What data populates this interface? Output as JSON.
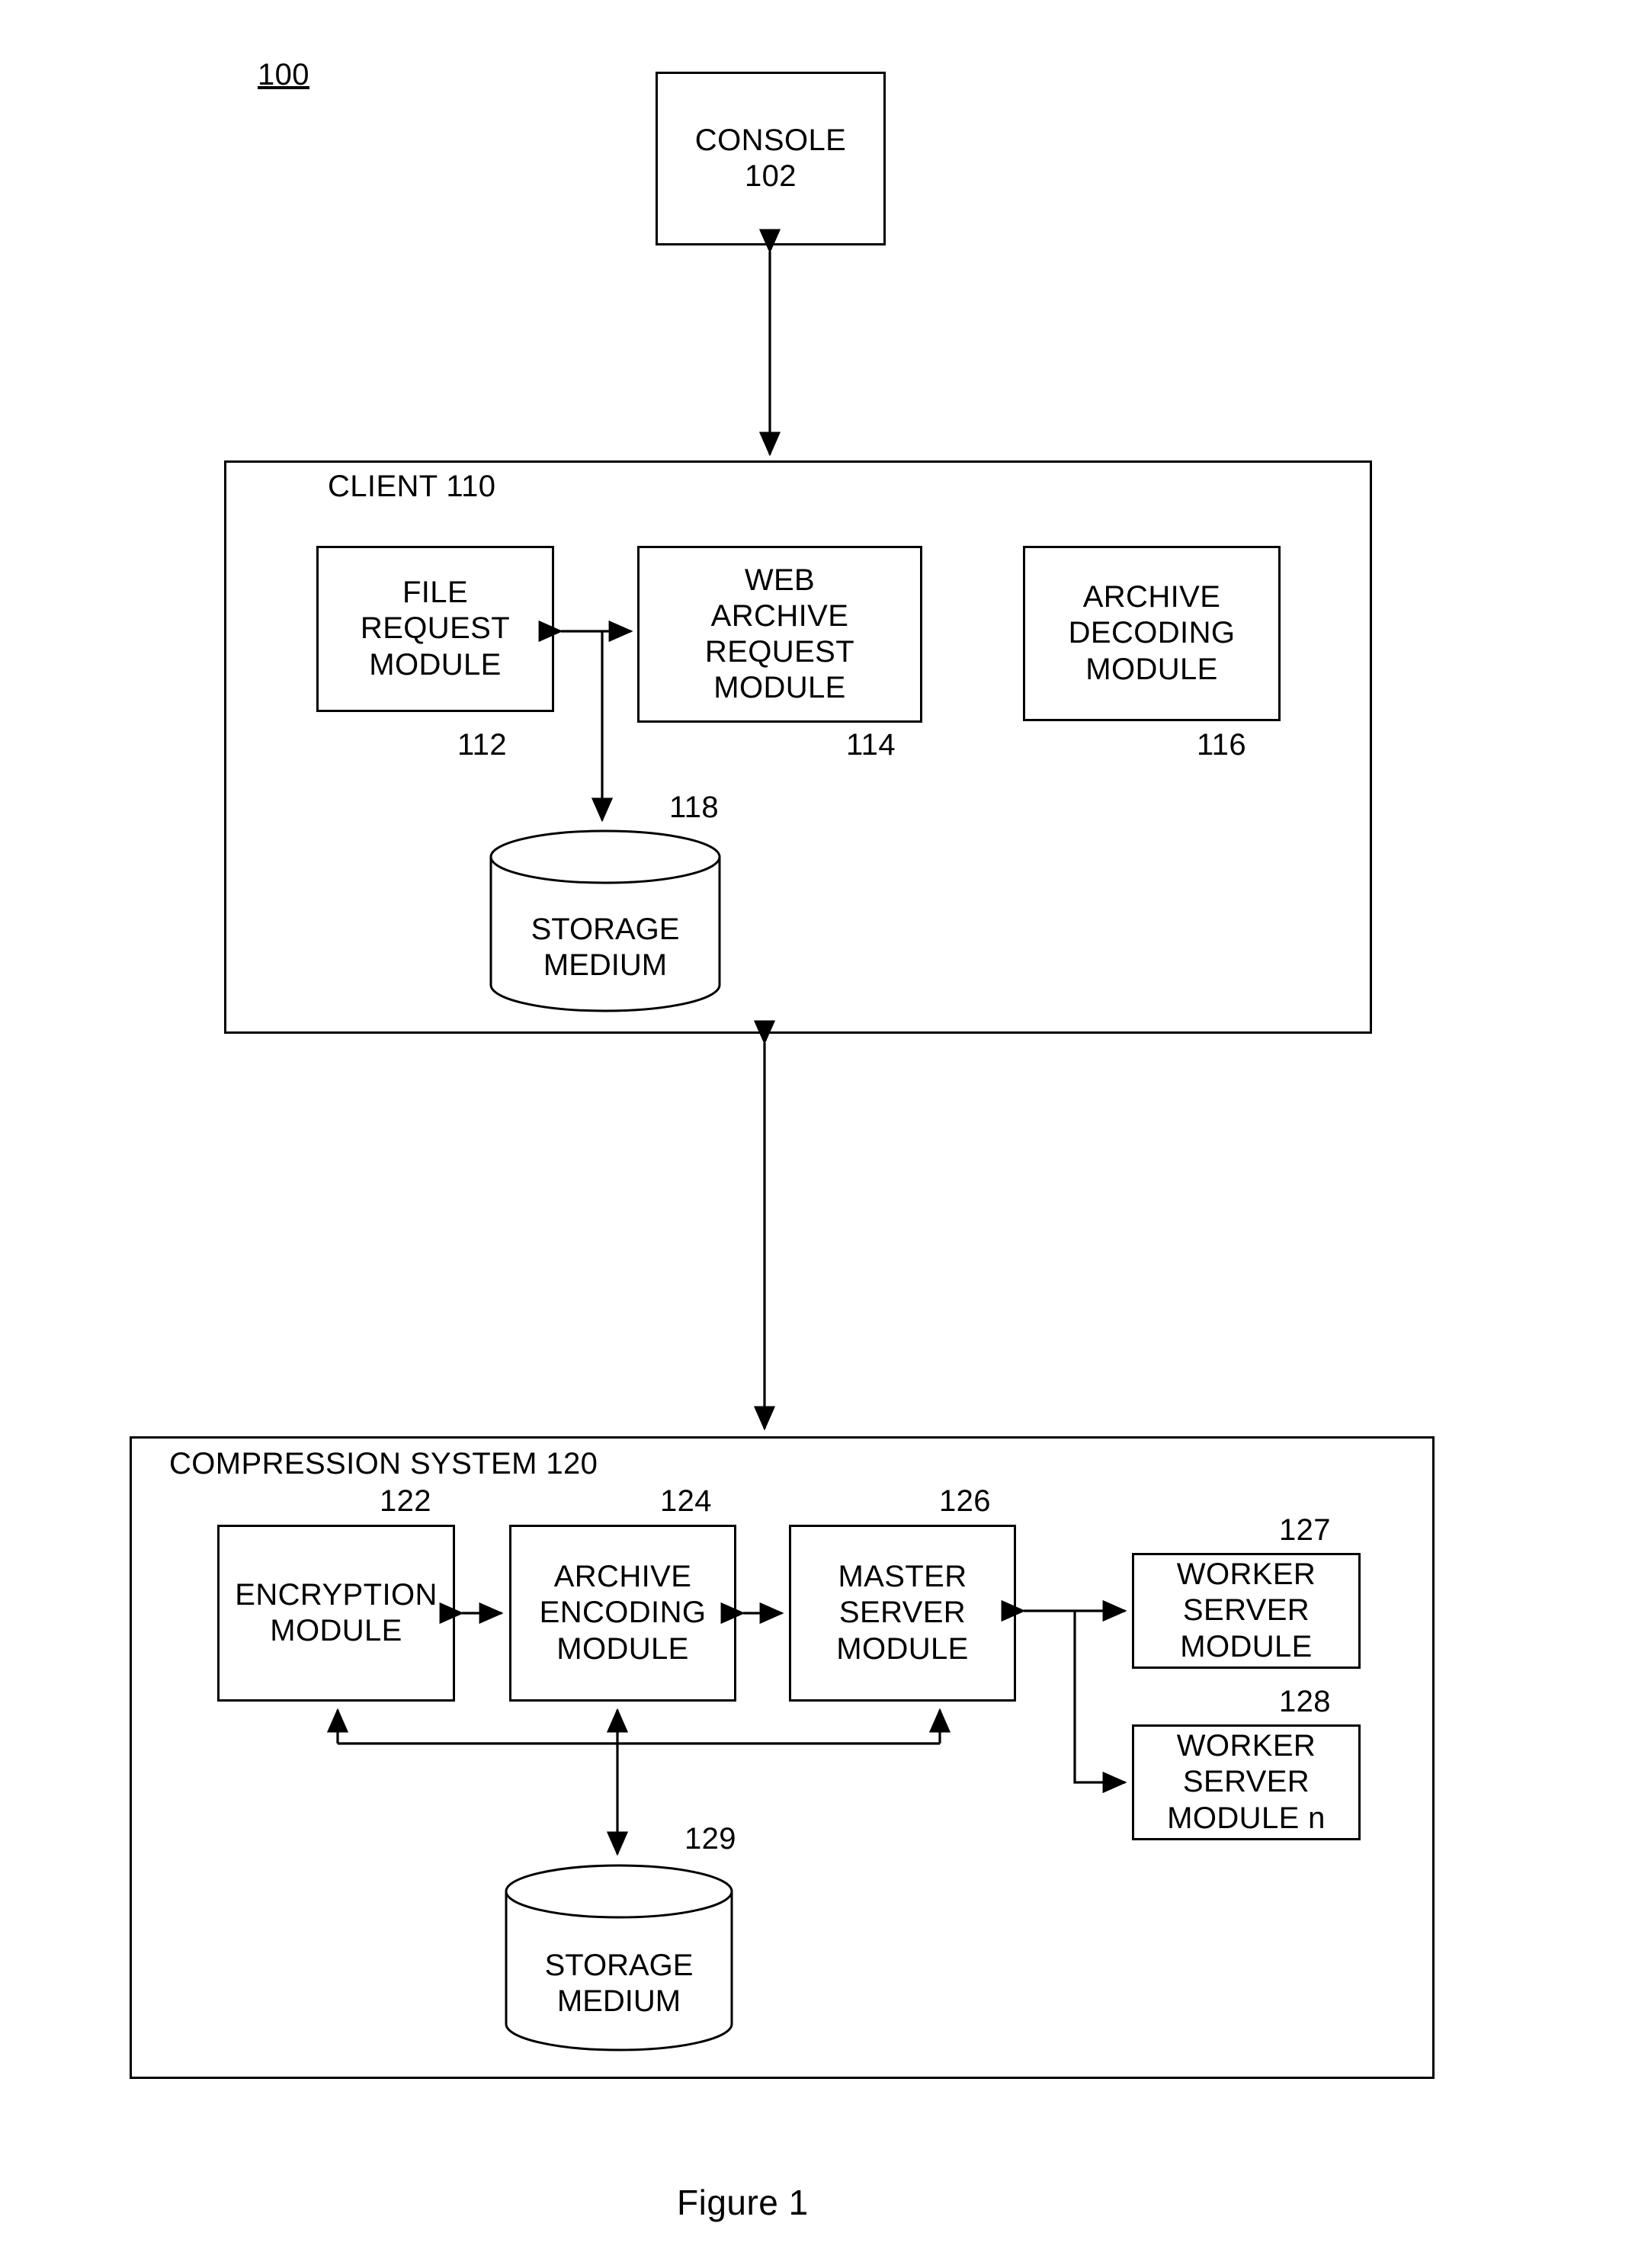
{
  "figure": {
    "system_ref": "100",
    "caption": "Figure 1"
  },
  "console": {
    "name": "CONSOLE",
    "ref": "102"
  },
  "client": {
    "title": "CLIENT 110",
    "modules": [
      {
        "name": "FILE\nREQUEST\nMODULE",
        "line1": "FILE",
        "line2": "REQUEST",
        "line3": "MODULE",
        "ref": "112"
      },
      {
        "name": "WEB ARCHIVE REQUEST MODULE",
        "line1": "WEB",
        "line2": "ARCHIVE",
        "line3": "REQUEST",
        "line4": "MODULE",
        "ref": "114"
      },
      {
        "name": "ARCHIVE DECODING MODULE",
        "line1": "ARCHIVE",
        "line2": "DECODING",
        "line3": "MODULE",
        "ref": "116"
      }
    ],
    "storage": {
      "line1": "STORAGE",
      "line2": "MEDIUM",
      "ref": "118"
    }
  },
  "compression_system": {
    "title": "COMPRESSION SYSTEM 120",
    "modules": [
      {
        "line1": "ENCRYPTION",
        "line2": "MODULE",
        "ref": "122"
      },
      {
        "line1": "ARCHIVE",
        "line2": "ENCODING",
        "line3": "MODULE",
        "ref": "124"
      },
      {
        "line1": "MASTER",
        "line2": "SERVER",
        "line3": "MODULE",
        "ref": "126"
      },
      {
        "line1": "WORKER",
        "line2": "SERVER",
        "line3": "MODULE",
        "ref": "127"
      },
      {
        "line1": "WORKER",
        "line2": "SERVER",
        "line3": "MODULE n",
        "ref": "128"
      }
    ],
    "storage": {
      "line1": "STORAGE",
      "line2": "MEDIUM",
      "ref": "129"
    }
  },
  "colors": {
    "ink": "#000000",
    "paper": "#ffffff"
  }
}
